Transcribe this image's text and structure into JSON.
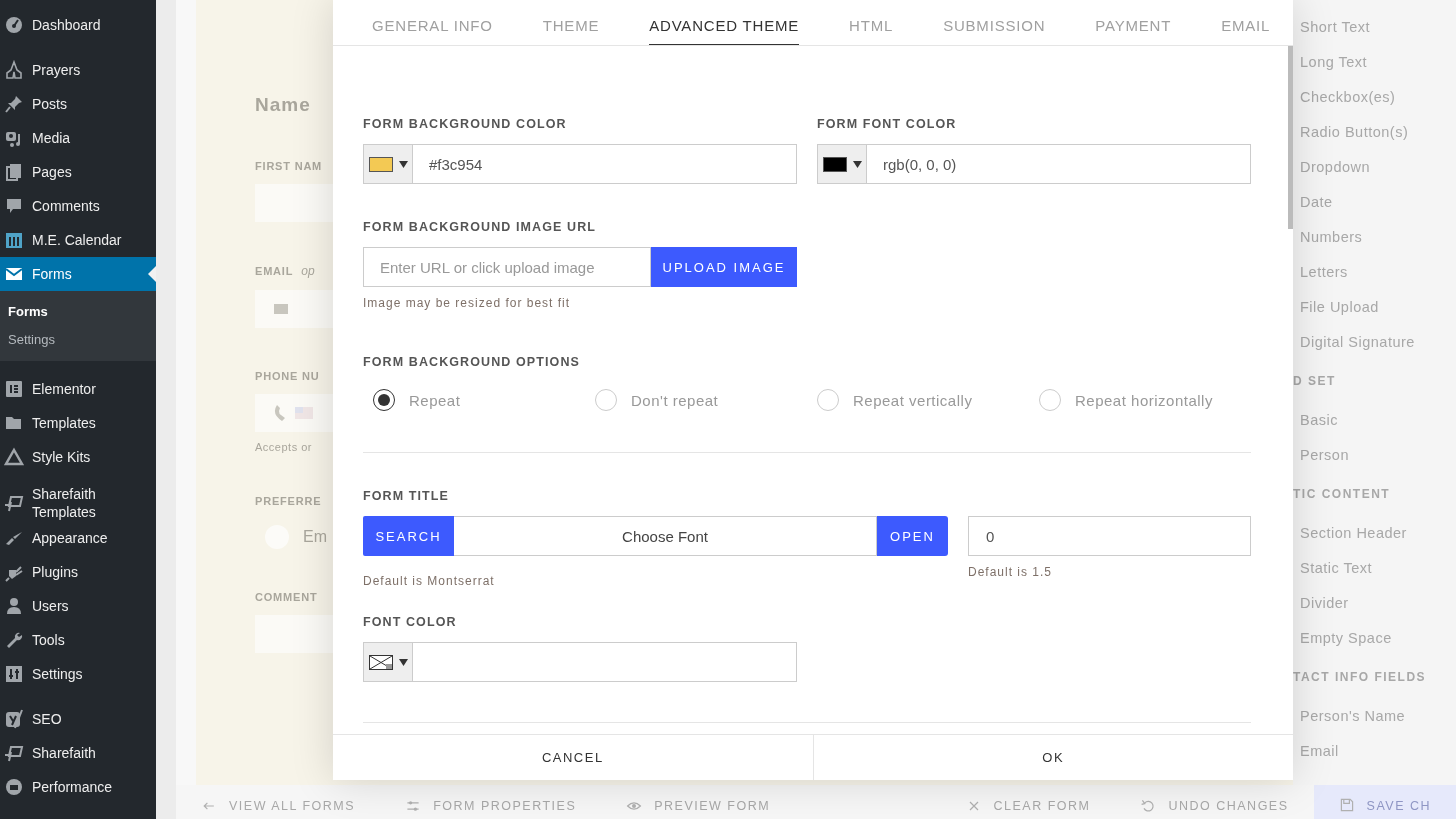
{
  "sidebar": {
    "groups": [
      [
        {
          "label": "Dashboard",
          "selected": false
        }
      ],
      [
        {
          "label": "Prayers",
          "selected": false
        },
        {
          "label": "Posts",
          "selected": false
        },
        {
          "label": "Media",
          "selected": false
        },
        {
          "label": "Pages",
          "selected": false
        },
        {
          "label": "Comments",
          "selected": false
        },
        {
          "label": "M.E. Calendar",
          "selected": false
        },
        {
          "label": "Forms",
          "selected": true,
          "children": [
            {
              "label": "Forms",
              "selected": true
            },
            {
              "label": "Settings",
              "selected": false
            }
          ]
        }
      ],
      [
        {
          "label": "Elementor",
          "selected": false
        },
        {
          "label": "Templates",
          "selected": false
        },
        {
          "label": "Style Kits",
          "selected": false
        }
      ],
      [
        {
          "label": "Sharefaith Templates",
          "selected": false
        },
        {
          "label": "Appearance",
          "selected": false
        },
        {
          "label": "Plugins",
          "selected": false
        },
        {
          "label": "Users",
          "selected": false
        },
        {
          "label": "Tools",
          "selected": false
        },
        {
          "label": "Settings",
          "selected": false
        }
      ],
      [
        {
          "label": "SEO",
          "selected": false
        },
        {
          "label": "Sharefaith",
          "selected": false
        },
        {
          "label": "Performance",
          "selected": false
        }
      ]
    ]
  },
  "form_preview": {
    "title": "Name",
    "fields": [
      {
        "kind": "text",
        "label": "FIRST NAM"
      },
      {
        "kind": "email",
        "label": "EMAIL",
        "note": "op"
      },
      {
        "kind": "phone",
        "label": "PHONE NU",
        "hint": "Accepts or"
      },
      {
        "kind": "radio",
        "label": "PREFERRE",
        "option": "Em"
      },
      {
        "kind": "textarea",
        "label": "COMMENT"
      }
    ]
  },
  "elements_panel": [
    {
      "kind": "item",
      "label": "Short Text"
    },
    {
      "kind": "item",
      "label": "Long Text"
    },
    {
      "kind": "item",
      "label": "Checkbox(es)"
    },
    {
      "kind": "item",
      "label": "Radio Button(s)"
    },
    {
      "kind": "item",
      "label": "Dropdown"
    },
    {
      "kind": "item",
      "label": "Date"
    },
    {
      "kind": "item",
      "label": "Numbers"
    },
    {
      "kind": "item",
      "label": "Letters"
    },
    {
      "kind": "item",
      "label": "File Upload"
    },
    {
      "kind": "item",
      "label": "Digital Signature"
    },
    {
      "kind": "heading",
      "label": "D SET"
    },
    {
      "kind": "item",
      "label": "Basic"
    },
    {
      "kind": "item",
      "label": "Person"
    },
    {
      "kind": "heading",
      "label": "TIC CONTENT"
    },
    {
      "kind": "item",
      "label": "Section Header"
    },
    {
      "kind": "item",
      "label": "Static Text"
    },
    {
      "kind": "item",
      "label": "Divider"
    },
    {
      "kind": "item",
      "label": "Empty Space"
    },
    {
      "kind": "heading",
      "label": "TACT INFO FIELDS"
    },
    {
      "kind": "item",
      "label": "Person's Name"
    },
    {
      "kind": "item",
      "label": "Email"
    }
  ],
  "toolbar": {
    "left": [
      {
        "kind": "back",
        "label": "VIEW ALL FORMS"
      },
      {
        "kind": "properties",
        "label": "FORM PROPERTIES"
      },
      {
        "kind": "preview",
        "label": "PREVIEW FORM"
      }
    ],
    "right": [
      {
        "kind": "clear",
        "label": "CLEAR FORM"
      },
      {
        "kind": "undo",
        "label": "UNDO CHANGES"
      },
      {
        "kind": "save",
        "label": "SAVE CH"
      }
    ]
  },
  "modal": {
    "tabs": [
      {
        "label": "GENERAL INFO",
        "selected": false
      },
      {
        "label": "THEME",
        "selected": false
      },
      {
        "label": "ADVANCED THEME",
        "selected": true
      },
      {
        "label": "HTML",
        "selected": false
      },
      {
        "label": "SUBMISSION",
        "selected": false
      },
      {
        "label": "PAYMENT",
        "selected": false
      },
      {
        "label": "EMAIL",
        "selected": false
      }
    ],
    "background_color": {
      "label": "FORM BACKGROUND COLOR",
      "color": "#f3c954",
      "value": "#f3c954"
    },
    "font_color": {
      "label": "FORM FONT COLOR",
      "color": "#000000",
      "value": "rgb(0, 0, 0)"
    },
    "background_image": {
      "label": "FORM BACKGROUND IMAGE URL",
      "placeholder": "Enter URL or click upload image",
      "button": "UPLOAD IMAGE",
      "hint": "Image may be resized for best fit"
    },
    "background_options": {
      "label": "FORM BACKGROUND OPTIONS",
      "options": [
        {
          "label": "Repeat",
          "selected": true
        },
        {
          "label": "Don't repeat",
          "selected": false
        },
        {
          "label": "Repeat vertically",
          "selected": false
        },
        {
          "label": "Repeat horizontally",
          "selected": false
        }
      ]
    },
    "form_title": {
      "label": "FORM TITLE",
      "search_button": "SEARCH",
      "font_value": "Choose Font",
      "open_button": "OPEN",
      "font_hint": "Default is Montserrat",
      "size_value": "0",
      "size_hint": "Default is 1.5"
    },
    "title_font_color": {
      "label": "FONT COLOR"
    },
    "footer": {
      "cancel": "CANCEL",
      "ok": "OK"
    }
  }
}
